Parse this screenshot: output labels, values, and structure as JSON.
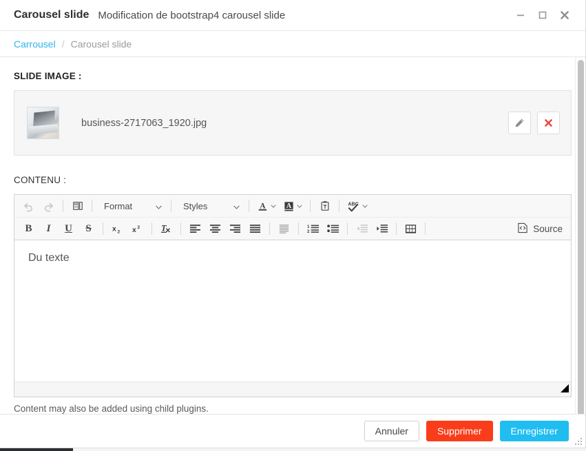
{
  "window": {
    "title": "Carousel slide",
    "subtitle": "Modification de bootstrap4 carousel slide",
    "minimize_label": "minimize-icon",
    "maximize_label": "maximize-icon",
    "close_label": "close-icon"
  },
  "breadcrumb": {
    "parent": "Carrousel",
    "separator": "/",
    "current": "Carousel slide",
    "link_color": "#2cb6ed"
  },
  "slide_image": {
    "label": "SLIDE IMAGE :",
    "filename": "business-2717063_1920.jpg",
    "edit_icon": "pencil-icon",
    "remove_icon": "red-x-icon",
    "remove_color": "#e8443a"
  },
  "content_field": {
    "label": "CONTENU :",
    "help_text": "Content may also be added using child plugins.",
    "editor": {
      "body_text": "Du texte",
      "source_label": "Source",
      "toolbar_row1": [
        {
          "name": "undo-icon",
          "type": "button",
          "disabled": true
        },
        {
          "name": "redo-icon",
          "type": "button",
          "disabled": true
        },
        {
          "name": "separator",
          "type": "separator"
        },
        {
          "name": "templates-icon",
          "type": "button",
          "disabled": false
        },
        {
          "name": "separator",
          "type": "separator"
        },
        {
          "name": "format-dropdown",
          "type": "combo",
          "label": "Format"
        },
        {
          "name": "separator",
          "type": "separator"
        },
        {
          "name": "styles-dropdown",
          "type": "combo",
          "label": "Styles"
        },
        {
          "name": "separator",
          "type": "separator"
        },
        {
          "name": "text-color-icon",
          "type": "button",
          "disabled": false
        },
        {
          "name": "background-color-icon",
          "type": "button",
          "disabled": false
        },
        {
          "name": "separator",
          "type": "separator"
        },
        {
          "name": "paste-as-text-icon",
          "type": "button",
          "disabled": false
        },
        {
          "name": "separator",
          "type": "separator"
        },
        {
          "name": "spellcheck-icon",
          "type": "button",
          "disabled": false
        }
      ],
      "toolbar_row2": [
        {
          "name": "bold-icon",
          "type": "button",
          "disabled": false
        },
        {
          "name": "italic-icon",
          "type": "button",
          "disabled": false
        },
        {
          "name": "underline-icon",
          "type": "button",
          "disabled": false
        },
        {
          "name": "strikethrough-icon",
          "type": "button",
          "disabled": false
        },
        {
          "name": "separator",
          "type": "separator"
        },
        {
          "name": "subscript-icon",
          "type": "button",
          "disabled": false
        },
        {
          "name": "superscript-icon",
          "type": "button",
          "disabled": false
        },
        {
          "name": "separator",
          "type": "separator"
        },
        {
          "name": "remove-format-icon",
          "type": "button",
          "disabled": false
        },
        {
          "name": "separator",
          "type": "separator"
        },
        {
          "name": "align-left-icon",
          "type": "button",
          "disabled": false
        },
        {
          "name": "align-center-icon",
          "type": "button",
          "disabled": false
        },
        {
          "name": "align-right-icon",
          "type": "button",
          "disabled": false
        },
        {
          "name": "align-justify-icon",
          "type": "button",
          "disabled": false
        },
        {
          "name": "separator",
          "type": "separator"
        },
        {
          "name": "blockquote-icon",
          "type": "button",
          "disabled": false
        },
        {
          "name": "separator",
          "type": "separator"
        },
        {
          "name": "numbered-list-icon",
          "type": "button",
          "disabled": false
        },
        {
          "name": "bulleted-list-icon",
          "type": "button",
          "disabled": false
        },
        {
          "name": "separator",
          "type": "separator"
        },
        {
          "name": "outdent-icon",
          "type": "button",
          "disabled": true
        },
        {
          "name": "indent-icon",
          "type": "button",
          "disabled": false
        },
        {
          "name": "separator",
          "type": "separator"
        },
        {
          "name": "table-icon",
          "type": "button",
          "disabled": false
        }
      ]
    }
  },
  "footer": {
    "cancel_label": "Annuler",
    "delete_label": "Supprimer",
    "save_label": "Enregistrer",
    "delete_color": "#f93d1b",
    "save_color": "#20bdf0"
  }
}
